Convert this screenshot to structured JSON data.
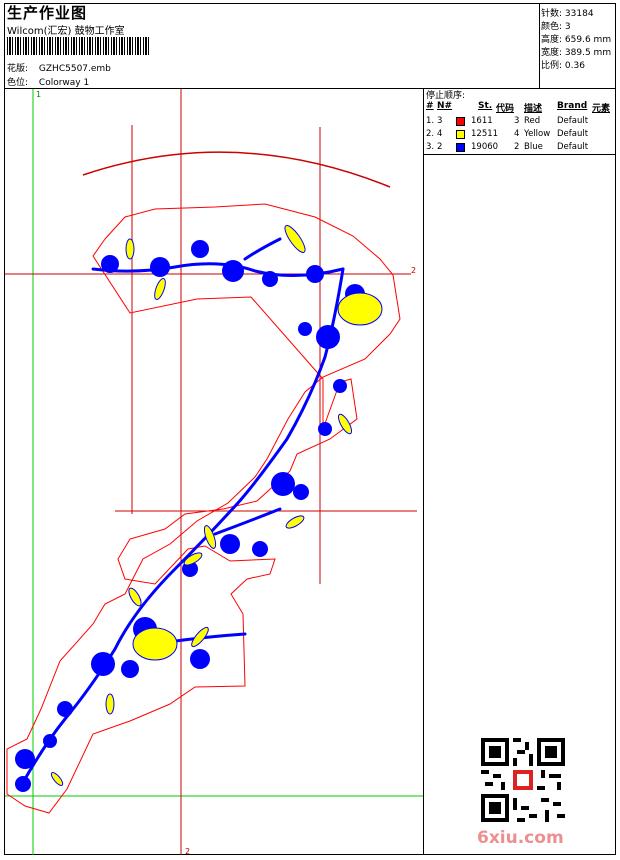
{
  "header": {
    "title": "生产作业图",
    "subtitle": "Wilcom(汇宏) 鼓物工作室",
    "design_file_label": "花版:",
    "design_file": "GZHC5507.emb",
    "colorway_label": "色位:",
    "colorway": "Colorway 1"
  },
  "stats": [
    {
      "label": "针数:",
      "value": "33184"
    },
    {
      "label": "颜色:",
      "value": "3"
    },
    {
      "label": "高度:",
      "value": "659.6 mm"
    },
    {
      "label": "宽度:",
      "value": "389.5 mm"
    },
    {
      "label": "比例:",
      "value": "0.36"
    }
  ],
  "stop_sequence": {
    "title": "停止顺序:",
    "columns": [
      "#",
      "N#",
      "St.",
      "代码",
      "描述",
      "Brand",
      "元素"
    ],
    "rows": [
      {
        "num": "1.",
        "needle": "3",
        "color": "#ff0000",
        "stitches": "1611",
        "code": "3",
        "desc": "Red",
        "brand": "Default"
      },
      {
        "num": "2.",
        "needle": "4",
        "color": "#ffff00",
        "stitches": "12511",
        "code": "4",
        "desc": "Yellow",
        "brand": "Default"
      },
      {
        "num": "3.",
        "needle": "2",
        "color": "#0000ff",
        "stitches": "19060",
        "code": "2",
        "desc": "Blue",
        "brand": "Default"
      }
    ]
  },
  "rulers": {
    "v_green": "1",
    "h_red": "2",
    "v_red": "2"
  },
  "watermark": "6xiu.com",
  "colors": {
    "outline": "#ff0000",
    "fill_yellow": "#ffff00",
    "fill_blue": "#0000ff",
    "guide_green": "#00cc00",
    "guide_red": "#cc0000"
  }
}
